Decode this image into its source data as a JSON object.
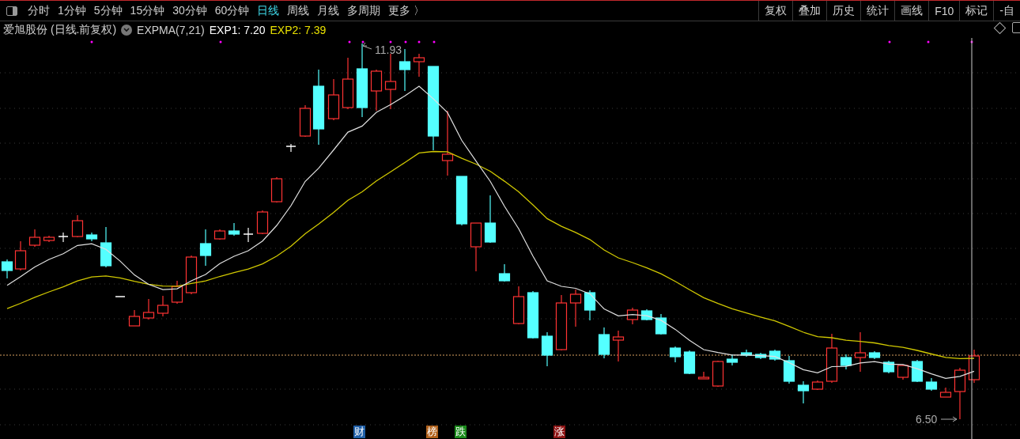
{
  "toolbar": {
    "periods": [
      {
        "label": "分时",
        "selected": false
      },
      {
        "label": "1分钟",
        "selected": false
      },
      {
        "label": "5分钟",
        "selected": false
      },
      {
        "label": "15分钟",
        "selected": false
      },
      {
        "label": "30分钟",
        "selected": false
      },
      {
        "label": "60分钟",
        "selected": false
      },
      {
        "label": "日线",
        "selected": true
      },
      {
        "label": "周线",
        "selected": false
      },
      {
        "label": "月线",
        "selected": false
      },
      {
        "label": "多周期",
        "selected": false
      },
      {
        "label": "更多 〉",
        "selected": false
      }
    ],
    "tools": [
      "复权",
      "叠加",
      "历史",
      "统计",
      "画线",
      "F10",
      "标记",
      "-自"
    ]
  },
  "legend": {
    "stock": "爱旭股份 (日线.前复权)",
    "indicator": "EXPMA(7,21)",
    "exp1": "EXP1: 7.20",
    "exp2": "EXP2: 7.39"
  },
  "chart": {
    "high_label": "11.93",
    "low_label": "6.50"
  },
  "event_markers": [
    {
      "label": "财",
      "color": "#1f5fa8"
    },
    {
      "label": "榜",
      "color": "#b0601a"
    },
    {
      "label": "跌",
      "color": "#1a8a1a"
    },
    {
      "label": "涨",
      "color": "#8e1414"
    }
  ]
}
